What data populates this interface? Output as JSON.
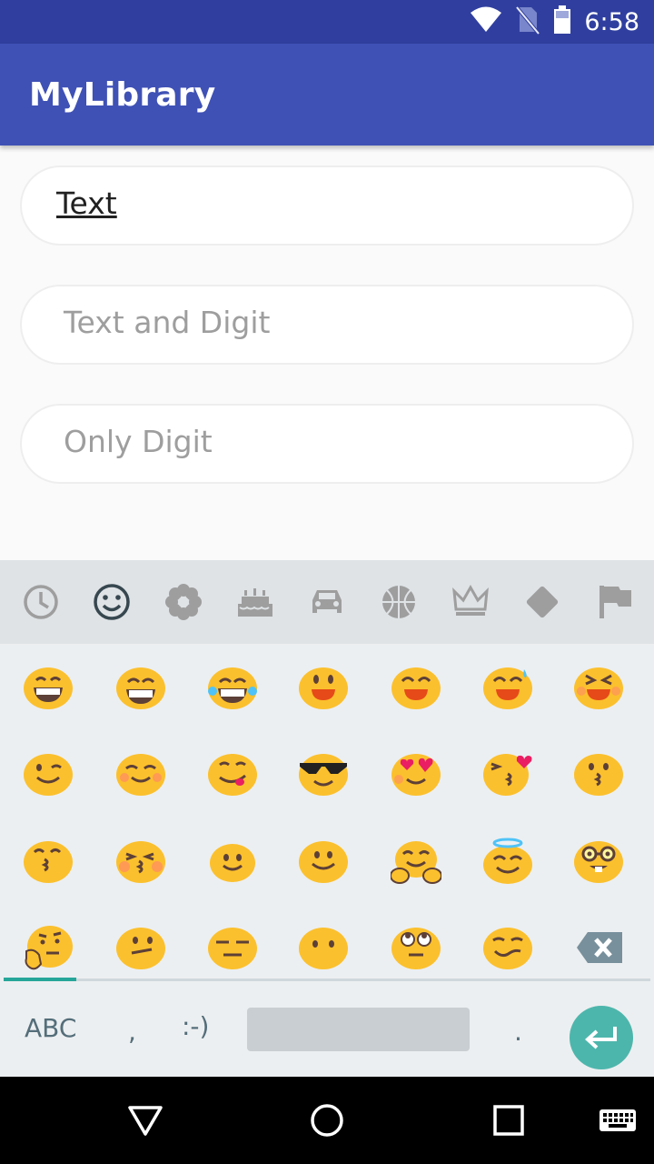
{
  "status_bar": {
    "time": "6:58",
    "icons": [
      "wifi-icon",
      "no-sim-icon",
      "battery-icon"
    ],
    "bg_color": "#303f9f"
  },
  "app_bar": {
    "title": "MyLibrary",
    "bg_color": "#3f51b5"
  },
  "fields": [
    {
      "value": "Text",
      "placeholder": ""
    },
    {
      "value": "",
      "placeholder": "Text and Digit"
    },
    {
      "value": "",
      "placeholder": "Only Digit"
    }
  ],
  "keyboard": {
    "categories": [
      "recent-icon",
      "smiley-icon",
      "flower-icon",
      "cake-icon",
      "car-icon",
      "basketball-icon",
      "crown-icon",
      "diamond-icon",
      "flag-icon"
    ],
    "selected_category": "smiley-icon",
    "emojis": [
      "grinning-face",
      "grinning-big-eyes",
      "tears-of-joy",
      "smiling-open-mouth",
      "smiling-smiling-eyes",
      "sweat-smile",
      "laughing-squinting",
      "winking-face",
      "blushing-face",
      "savoring-food",
      "smiling-sunglasses",
      "heart-eyes",
      "blowing-kiss",
      "kissing-face",
      "kissing-smiling-eyes",
      "kissing-closed-eyes",
      "slightly-smiling",
      "smiling-face",
      "hugging-face",
      "halo-face",
      "nerd-face",
      "thinking-face",
      "neutral-face",
      "expressionless-face",
      "no-mouth-face",
      "rolling-eyes",
      "smirking-face"
    ],
    "delete_key": "backspace-icon",
    "abc_label": "ABC",
    "comma_label": ",",
    "emoticon_label": ":-)",
    "period_label": ".",
    "enter_key": "enter-icon",
    "accent_color": "#26a69a"
  },
  "nav_bar": {
    "buttons": [
      "back-icon",
      "home-icon",
      "recents-icon",
      "keyboard-icon"
    ]
  }
}
